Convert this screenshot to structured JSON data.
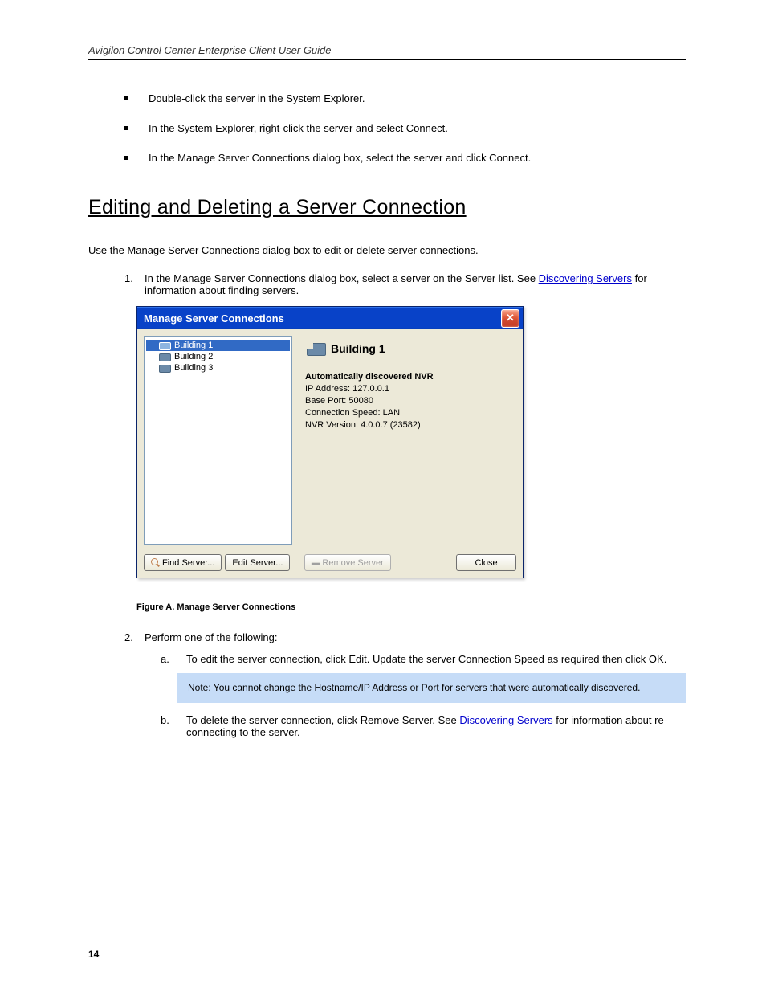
{
  "header": "Avigilon Control Center Enterprise Client User Guide",
  "section_title": "Editing and Deleting a Server Connection",
  "bullets": [
    "Double-click the server in the System Explorer.",
    "In the System Explorer, right-click the server and select Connect.",
    "In the Manage Server Connections dialog box, select the server and click Connect."
  ],
  "intro": "Use the Manage Server Connections dialog box to edit or delete server connections.",
  "step1": {
    "num": "1.",
    "text_a": "In the Manage Server Connections dialog box, select a server on the Server list. See ",
    "link": "Discovering Servers",
    "text_b": " for information about finding servers."
  },
  "dialog": {
    "title": "Manage Server Connections",
    "servers": [
      "Building 1",
      "Building 2",
      "Building 3"
    ],
    "selected": "Building 1",
    "details_title": "Building 1",
    "details": {
      "heading": "Automatically discovered NVR",
      "ip": "IP Address: 127.0.0.1",
      "port": "Base Port: 50080",
      "speed": "Connection Speed: LAN",
      "version": "NVR Version: 4.0.0.7 (23582)"
    },
    "buttons": {
      "find": "Find Server...",
      "edit": "Edit Server...",
      "remove": "Remove Server",
      "close": "Close"
    }
  },
  "figure_caption": "Figure A.  Manage Server Connections",
  "step2": {
    "num": "2.",
    "text": "Perform one of the following:"
  },
  "sub_a": {
    "letter": "a.",
    "text": "To edit the server connection, click Edit. Update the server Connection Speed as required then click OK."
  },
  "note": "Note: You cannot change the Hostname/IP Address or Port for servers that were automatically discovered.",
  "sub_b": {
    "letter": "b.",
    "text_a": "To delete the server connection, click Remove Server. See ",
    "link": "Discovering Servers",
    "text_b": " for information about re-connecting to the server."
  },
  "page_number": "14"
}
